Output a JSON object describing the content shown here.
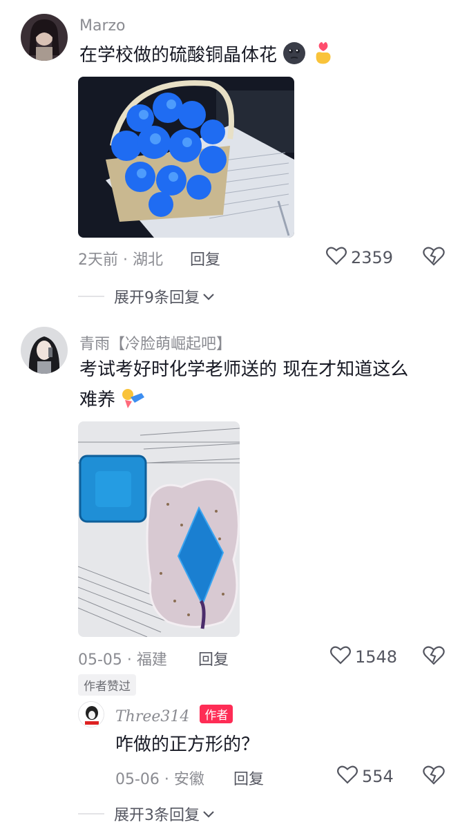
{
  "comments": [
    {
      "username": "Marzo",
      "text": "在学校做的硫酸铜晶体花",
      "emoji_icons": [
        "moon-face-icon",
        "finger-heart-icon"
      ],
      "photo_description_icon": "blue-crystal-flower-basket-photo",
      "date": "2天前",
      "location": "湖北",
      "date_location": "2天前 · 湖北",
      "reply_label": "回复",
      "likes": "2359",
      "expand_label": "展开9条回复"
    },
    {
      "username": "青雨【冷脸萌崛起吧】",
      "text_line1": "考试考好时化学老师送的 现在才知道这么",
      "text_line2": "难养",
      "emoji_icons": [
        "running-emoji-icon"
      ],
      "photo_description_icon": "blue-crystal-cubes-photo",
      "date_location": "05-05 · 福建",
      "reply_label": "回复",
      "likes": "1548",
      "author_liked_badge": "作者赞过",
      "replies": [
        {
          "username": "Three314",
          "author_tag": "作者",
          "text": "咋做的正方形的？",
          "date_location": "05-06 · 安徽",
          "reply_label": "回复",
          "likes": "554"
        }
      ],
      "expand_label": "展开3条回复"
    }
  ],
  "colors": {
    "primary_text": "#161823",
    "secondary_text": "#8a8b91",
    "author_tag_bg": "#fe2c55"
  }
}
